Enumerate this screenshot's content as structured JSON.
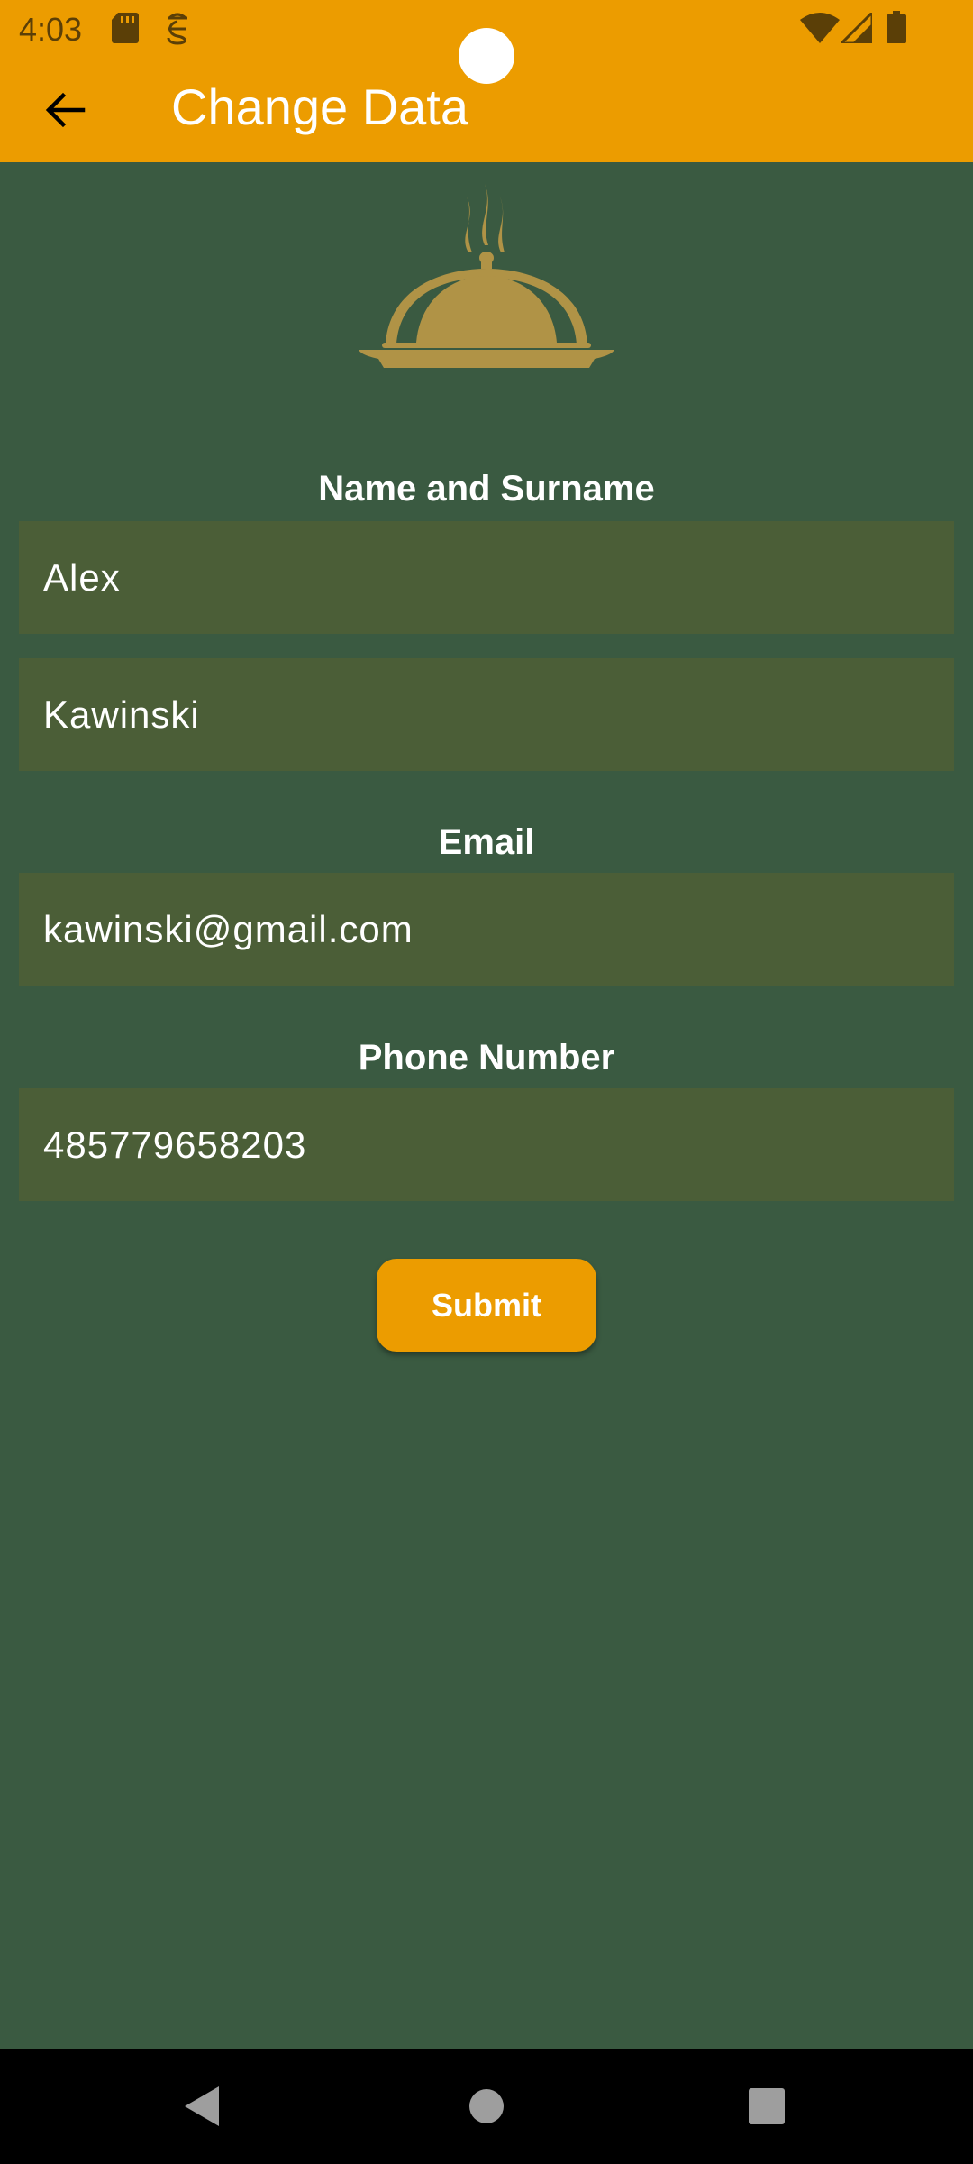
{
  "status_bar": {
    "time": "4:03",
    "left_icons": [
      "sd-card-icon",
      "sync-icon"
    ],
    "right_icons": [
      "wifi-icon",
      "signal-icon",
      "battery-icon"
    ]
  },
  "toolbar": {
    "title": "Change Data",
    "back_icon": "arrow-left-icon"
  },
  "logo": {
    "icon": "serving-cloche-icon"
  },
  "form": {
    "name_label": "Name and Surname",
    "first_name_value": "Alex",
    "last_name_value": "Kawinski",
    "email_label": "Email",
    "email_value": "kawinski@gmail.com",
    "phone_label": "Phone Number",
    "phone_value": "485779658203",
    "submit_label": "Submit"
  },
  "nav_bar": {
    "back_icon": "nav-back-icon",
    "home_icon": "nav-home-icon",
    "recents_icon": "nav-recents-icon"
  },
  "colors": {
    "accent": "#ec9c00",
    "background": "#3a5a41",
    "field_background": "#4b5e37",
    "logo": "#b09346"
  }
}
